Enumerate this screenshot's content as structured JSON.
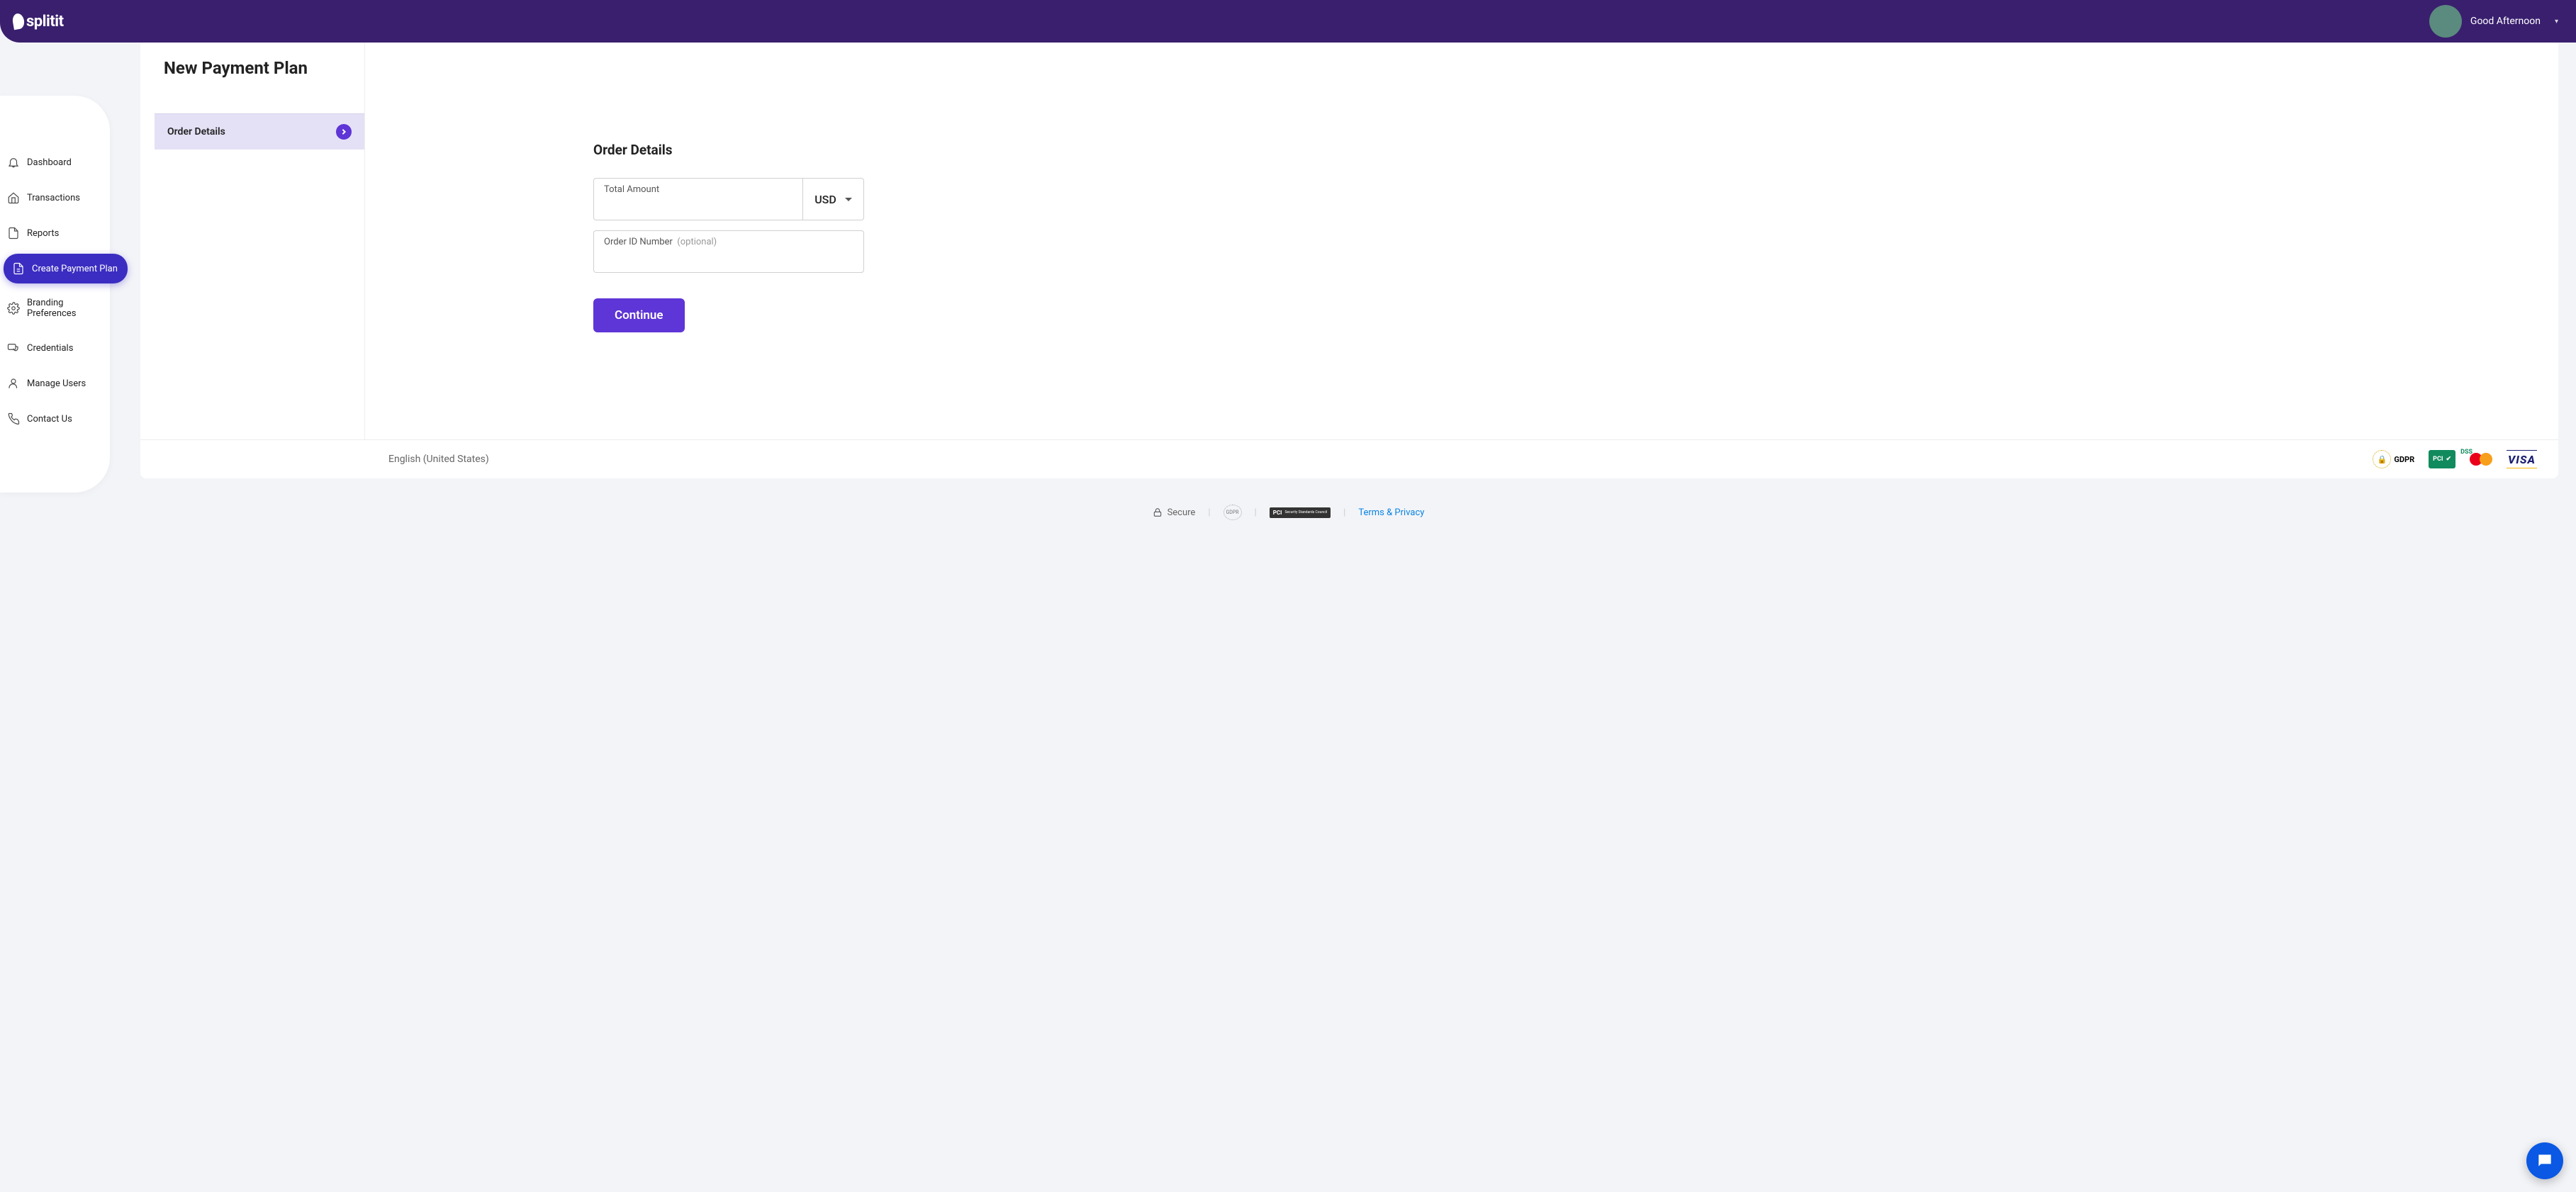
{
  "brand": "splitit",
  "header": {
    "greeting": "Good Afternoon",
    "chevron": "▾"
  },
  "sidebar": {
    "items": [
      {
        "label": "Dashboard",
        "icon": "bell"
      },
      {
        "label": "Transactions",
        "icon": "home"
      },
      {
        "label": "Reports",
        "icon": "file"
      },
      {
        "label": "Create Payment Plan",
        "icon": "file-plus",
        "active": true
      },
      {
        "label": "Branding Preferences",
        "icon": "gear"
      },
      {
        "label": "Credentials",
        "icon": "shield-card"
      },
      {
        "label": "Manage Users",
        "icon": "user"
      },
      {
        "label": "Contact Us",
        "icon": "phone"
      }
    ]
  },
  "page": {
    "title": "New Payment Plan",
    "steps": [
      {
        "title": "Order Details",
        "active": true
      }
    ]
  },
  "form": {
    "section_title": "Order Details",
    "amount_label": "Total Amount",
    "amount_value": "",
    "currency": "USD",
    "order_id_label": "Order ID Number",
    "order_id_hint": "(optional)",
    "order_id_value": "",
    "continue_label": "Continue"
  },
  "card_footer": {
    "language": "English (United States)",
    "badges": {
      "gdpr": "GDPR",
      "pcidss": "PCI",
      "mastercard": "mastercard",
      "visa": "VISA"
    }
  },
  "page_footer": {
    "secure": "Secure",
    "gdpr": "GDPR",
    "pci": "PCI",
    "pci_sub": "Security Standards Council",
    "terms": "Terms & Privacy"
  }
}
